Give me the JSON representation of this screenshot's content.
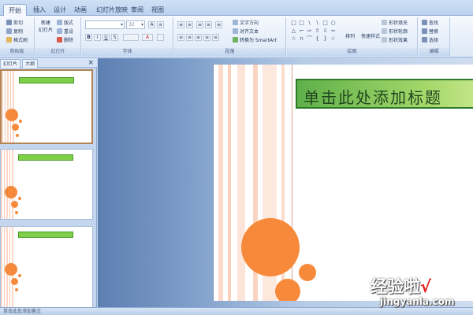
{
  "ribbon_tabs": [
    "开始",
    "插入",
    "设计",
    "动画",
    "幻灯片放映",
    "审阅",
    "视图"
  ],
  "clipboard": {
    "cut": "剪切",
    "copy": "复制",
    "format_painter": "格式刷",
    "group_label": "剪贴板"
  },
  "slides_group": {
    "new_slide": "新建\n幻灯片",
    "layout": "版式",
    "reset": "重设",
    "delete": "删除",
    "group_label": "幻灯片"
  },
  "font_group": {
    "font_size": "32",
    "bold": "B",
    "italic": "I",
    "underline": "U",
    "strike": "S",
    "group_label": "字体"
  },
  "paragraph_group": {
    "text_direction": "文字方向",
    "align_text": "对齐文本",
    "convert_smartart": "转换为 SmartArt",
    "group_label": "段落"
  },
  "drawing_group": {
    "arrange": "排列",
    "quick_styles": "快速样式",
    "shape_fill": "形状填充",
    "shape_outline": "形状轮廓",
    "shape_effects": "形状效果",
    "group_label": "绘图"
  },
  "editing_group": {
    "find": "查找",
    "replace": "替换",
    "select": "选择",
    "group_label": "编辑"
  },
  "pane": {
    "tab_slides": "幻灯片",
    "tab_outline": "大纲",
    "close": "×"
  },
  "slide": {
    "title_placeholder": "单击此处添加标题"
  },
  "status_bar": {
    "text": "单击此处添加备注"
  },
  "watermark": {
    "brand": "经验啦",
    "check": "√",
    "url": "jingyanla.com"
  },
  "colors": {
    "accent_orange": "#f78a3a",
    "title_green": "#7fcf4b",
    "ribbon_blue": "#dce8f7"
  }
}
